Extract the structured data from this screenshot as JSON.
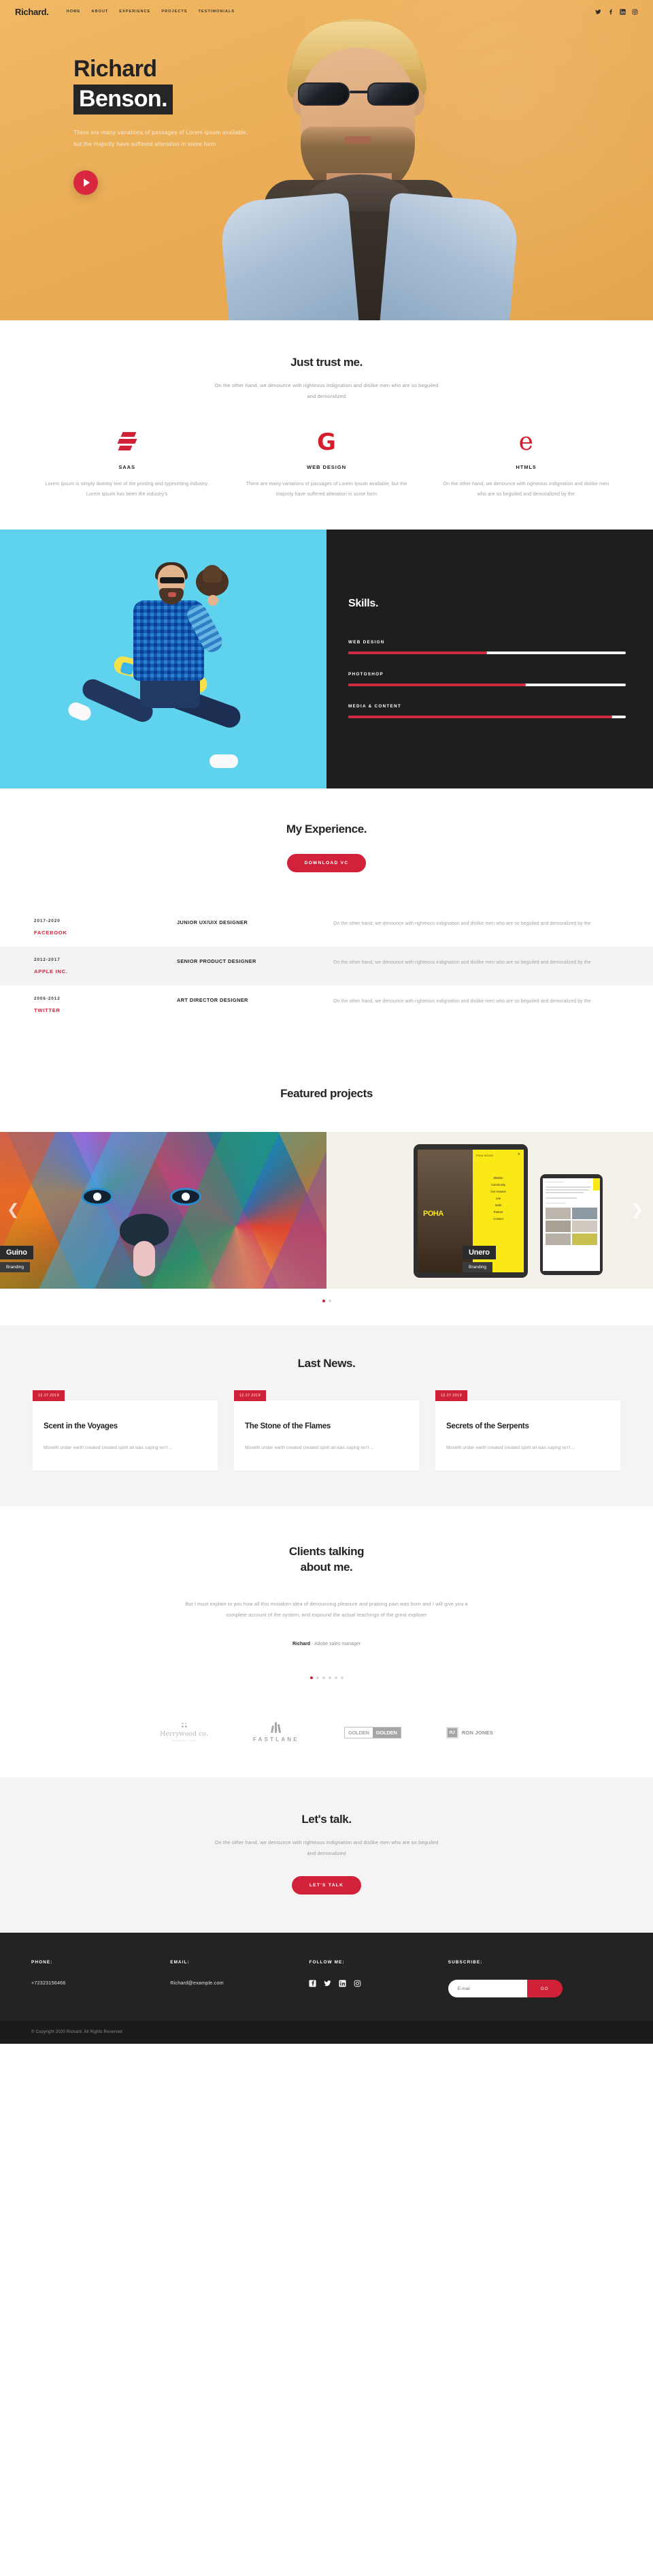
{
  "nav": {
    "brand": "Richard.",
    "links": [
      "HOME",
      "ABOUT",
      "EXPERIENCE",
      "PROJECTS",
      "TESTIMONIALS"
    ],
    "social": [
      "twitter-icon",
      "facebook-icon",
      "linkedin-icon",
      "instagram-icon"
    ]
  },
  "hero": {
    "line1": "Richard",
    "line2": "Benson.",
    "subtitle": "There are many variations of passages of Lorem Ipsum available, but the majority have suffered alteration in some form",
    "play_label": "play-video",
    "bg_color": "#eeb25e",
    "accent": "#d8273f"
  },
  "trust": {
    "title": "Just trust me.",
    "subtitle": "On the other hand, we denounce with righteous indignation and dislike men who are so beguiled and demoralized",
    "columns": [
      {
        "icon": "saas-icon",
        "label": "SAAS",
        "text": "Lorem Ipsum is simply dummy text of the printing and typesetting industry. Lorem Ipsum has been the industry's"
      },
      {
        "icon": "google-g-icon",
        "label": "WEB DESIGN",
        "text": "There are many variations of passages of Lorem Ipsum available, but the majority have suffered alteration in some form"
      },
      {
        "icon": "edge-e-icon",
        "label": "HTML5",
        "text": "On the other hand, we denounce with righteous indignation and dislike men who are so beguiled and demoralized by the"
      }
    ]
  },
  "skills": {
    "title": "Skills.",
    "bars": [
      {
        "label": "WEB DESIGN",
        "value": 50
      },
      {
        "label": "PHOTOSHOP",
        "value": 64
      },
      {
        "label": "MEDIA & CONTENT",
        "value": 95
      }
    ]
  },
  "experience": {
    "title": "My Experience.",
    "download_label": "DOWNLOAD VC",
    "rows": [
      {
        "years": "2017-2020",
        "company": "FACEBOOK",
        "role": "JUNIOR UX/UIX DESIGNER",
        "text": "On the other hand, we denounce with righteous indignation and dislike men who are so beguiled and demoralized by the"
      },
      {
        "years": "2012-2017",
        "company": "APPLE INC.",
        "role": "SENIOR PRODUCT DESIGNER",
        "text": "On the other hand, we denounce with righteous indignation and dislike men who are so beguiled and demoralized by the"
      },
      {
        "years": "2006-2012",
        "company": "TWITTER",
        "role": "ART DIRECTOR DESIGNER",
        "text": "On the other hand, we denounce with righteous indignation and dislike men who are so beguiled and demoralized by the"
      }
    ]
  },
  "projects": {
    "title": "Featured projects",
    "slides": [
      {
        "name": "Guino",
        "category": "Branding"
      },
      {
        "name": "Unero",
        "category": "Branding"
      }
    ],
    "device_menu": {
      "header": "POHA HOUSE",
      "close": "✕",
      "items": [
        "Mission",
        "Community",
        "Our Houses",
        "Live",
        "Work",
        "Partner",
        "Contact"
      ],
      "logo": "POHA"
    },
    "prev": "❮",
    "next": "❯",
    "dots": 2,
    "active_dot": 0
  },
  "news": {
    "title": "Last News.",
    "cards": [
      {
        "date": "12.27.2019",
        "title": "Scent in the Voyages",
        "excerpt": "Moveth under earth created created spirit all was saying isn't ..."
      },
      {
        "date": "12.27.2019",
        "title": "The Stone of the Flames",
        "excerpt": "Moveth under earth created created spirit all was saying isn't ..."
      },
      {
        "date": "12.27.2019",
        "title": "Secrets of the Serpents",
        "excerpt": "Moveth under earth created created spirit all was saying isn't ..."
      }
    ]
  },
  "testimonials": {
    "title_line1": "Clients talking",
    "title_line2": "about me.",
    "quote": "But I must explain to you how all this mistaken idea of denouncing pleasure and praising pain was born and I will give you a complete account of the system, and expound the actual teachings of the great explorer",
    "author_name": "Richard",
    "author_role": "- Adobe sales manager",
    "dots": 6,
    "active_dot": 0
  },
  "clients": [
    {
      "name": "Herrywood co.",
      "tagline": "herrywood we minerals"
    },
    {
      "name": "FASTLANE"
    },
    {
      "name_a": "GOLDEN",
      "name_b": "GOLDEN"
    },
    {
      "initials": "RJ",
      "name": "RON JONES"
    }
  ],
  "cta": {
    "title": "Let's talk.",
    "subtitle": "On the other hand, we denounce with righteous indignation and dislike men who are so beguiled and demoralized",
    "button": "LET'S TALK"
  },
  "footer": {
    "phone_label": "PHONE:",
    "phone_value": "+72323156466",
    "email_label": "EMAIL:",
    "email_value": "Richard@example.com",
    "follow_label": "FOLLOW ME:",
    "social": [
      "facebook-icon",
      "twitter-icon",
      "linkedin-icon",
      "instagram-icon"
    ],
    "subscribe_label": "SUBSCRIBE:",
    "email_placeholder": "E-mail",
    "email_input_value": "",
    "go_label": "GO",
    "copyright": "© Copyright 2020 Richard. All Rights Reserved"
  }
}
